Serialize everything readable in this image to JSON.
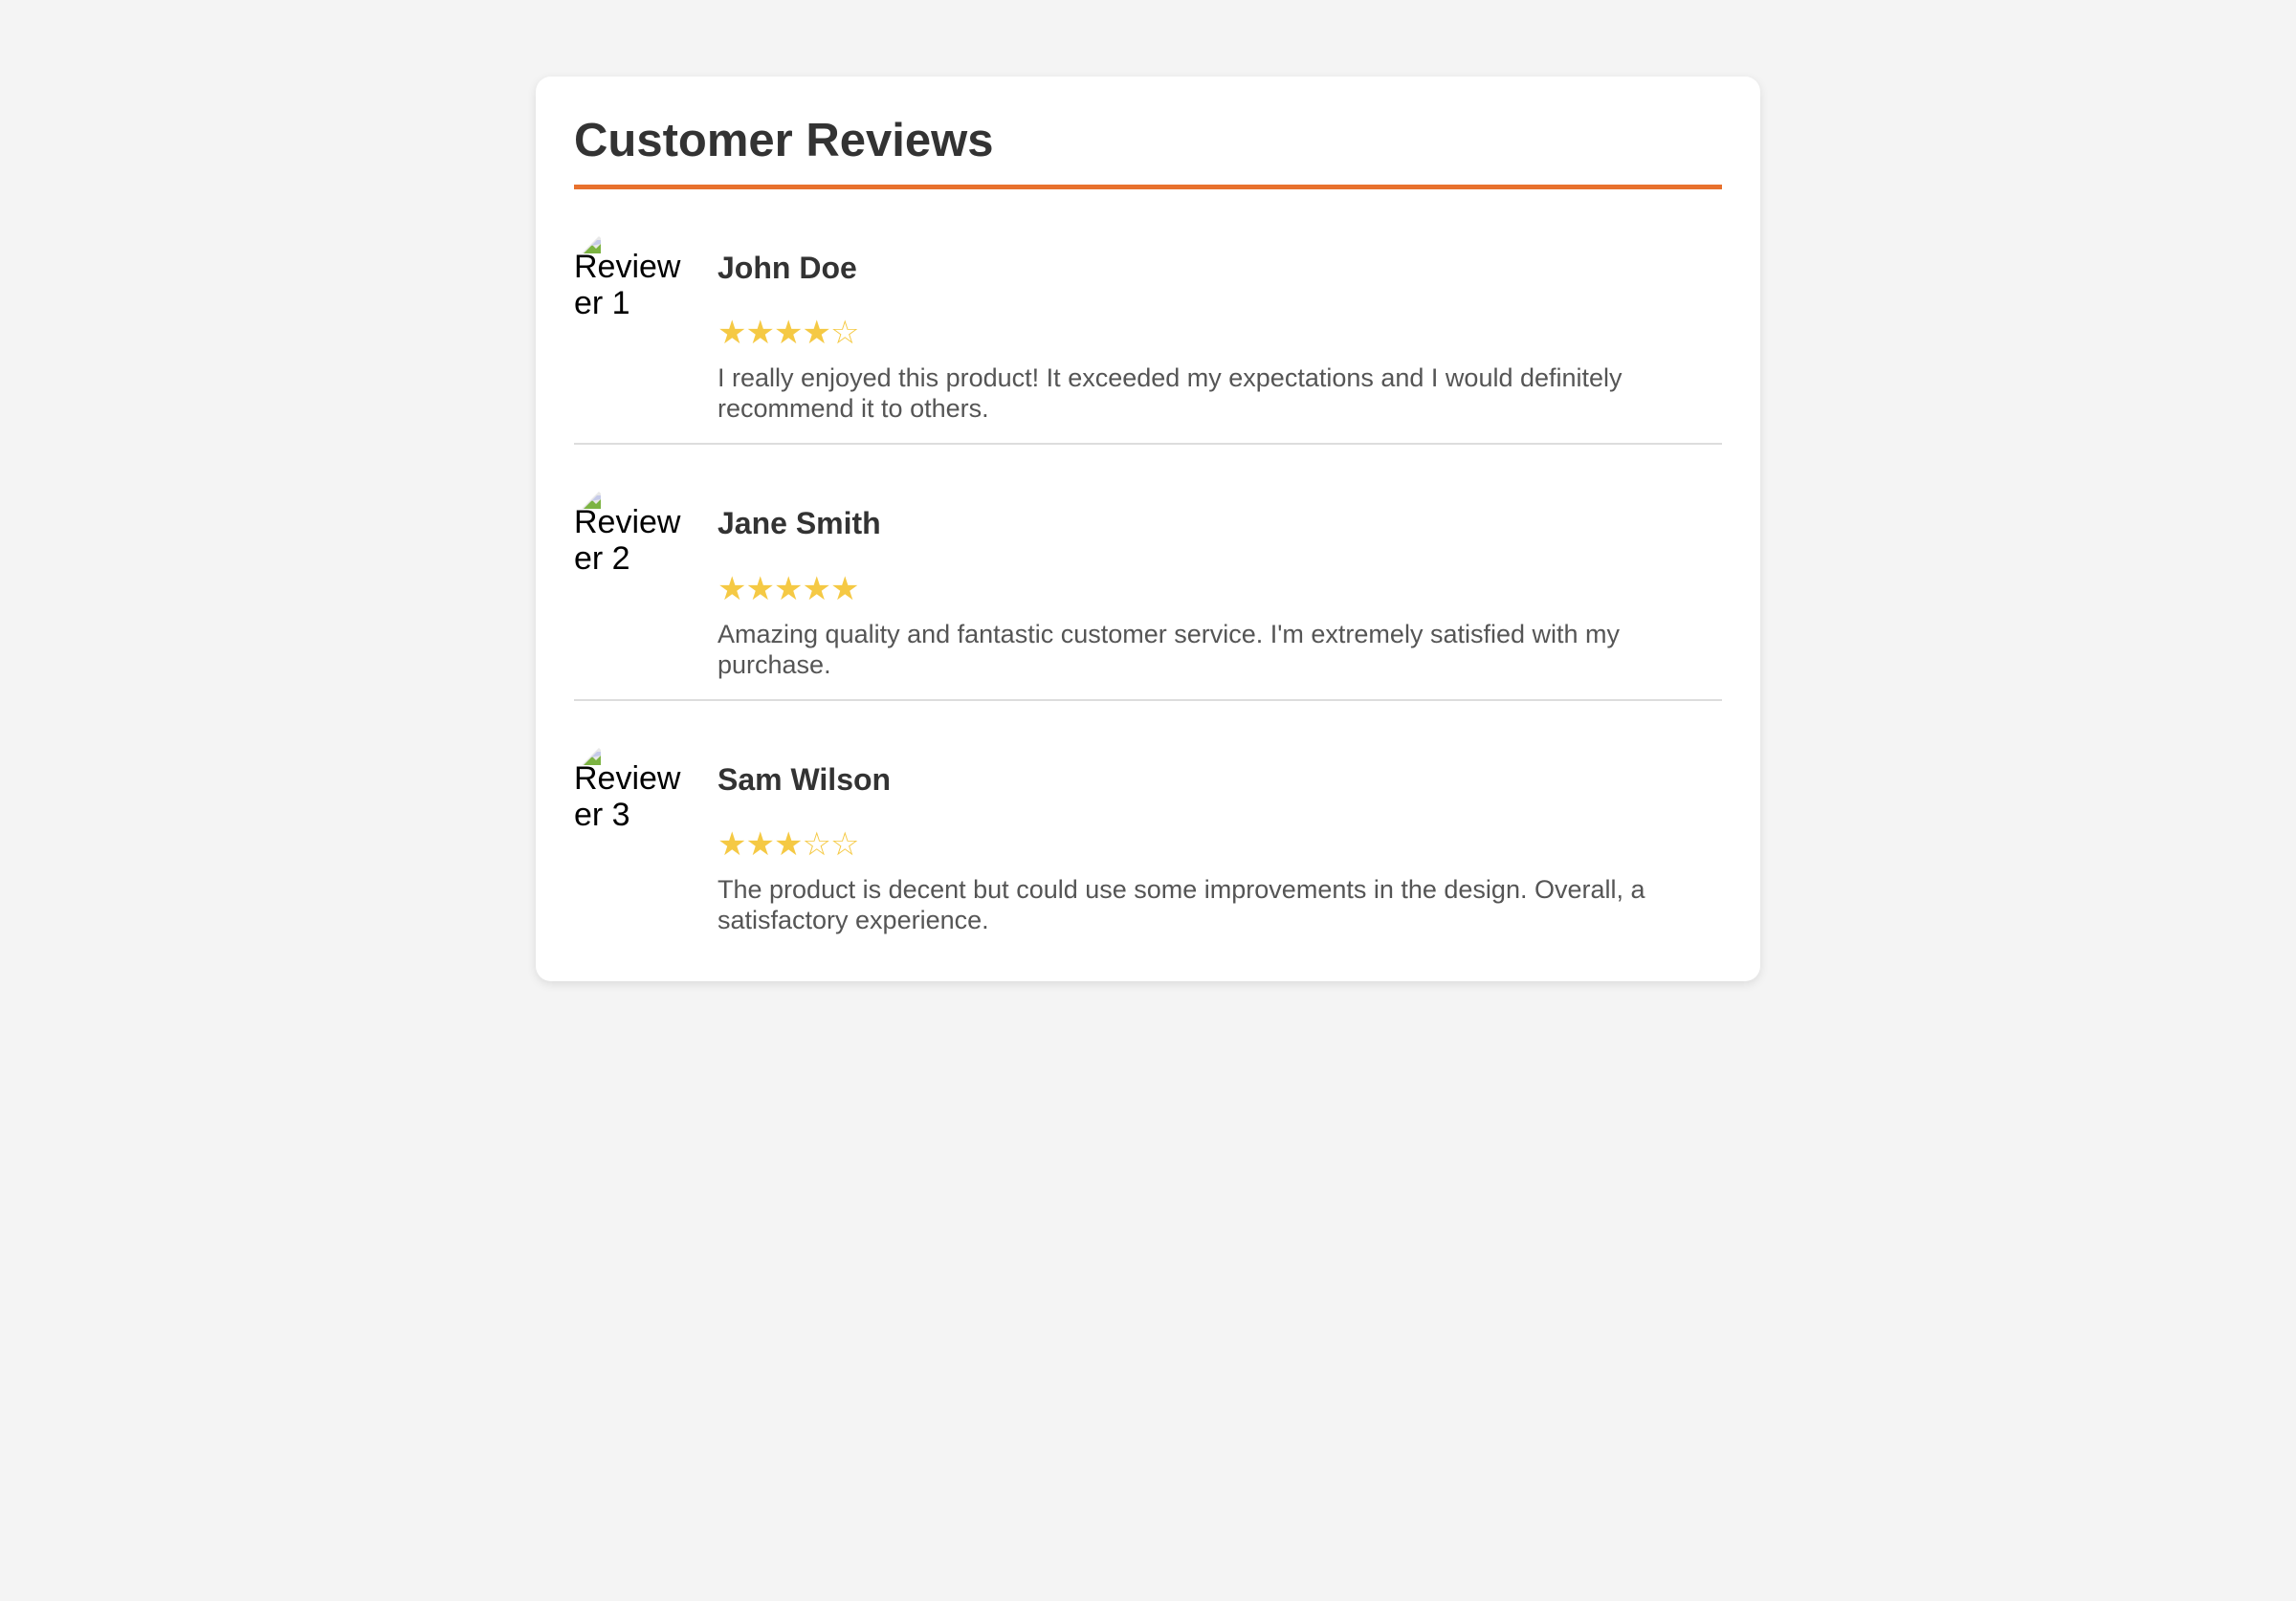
{
  "page": {
    "title": "Customer Reviews",
    "accent_color": "#e8712d",
    "star_color": "#f5c944"
  },
  "reviews": [
    {
      "avatar_alt": "Reviewer 1",
      "name": "John Doe",
      "rating": 4,
      "stars_max": 5,
      "text": "I really enjoyed this product! It exceeded my expectations and I would definitely recommend it to others."
    },
    {
      "avatar_alt": "Reviewer 2",
      "name": "Jane Smith",
      "rating": 5,
      "stars_max": 5,
      "text": "Amazing quality and fantastic customer service. I'm extremely satisfied with my purchase."
    },
    {
      "avatar_alt": "Reviewer 3",
      "name": "Sam Wilson",
      "rating": 3,
      "stars_max": 5,
      "text": "The product is decent but could use some improvements in the design. Overall, a satisfactory experience."
    }
  ],
  "icons": {
    "broken_image": "broken-image-icon",
    "star_filled": "★",
    "star_empty": "☆"
  }
}
